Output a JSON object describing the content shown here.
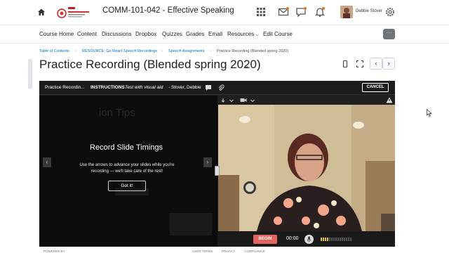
{
  "header": {
    "course_title": "COMM-101-042 - Effective Speaking",
    "user_name": "Debbie Stover",
    "icons": [
      "home-icon",
      "grid-icon",
      "mail-icon",
      "chat-icon",
      "bell-icon",
      "gear-icon"
    ]
  },
  "nav": {
    "items": [
      "Course Home",
      "Content",
      "Discussions",
      "Dropbox",
      "Quizzes",
      "Grades",
      "Email",
      "Resources",
      "Edit Course"
    ],
    "more_label": "···"
  },
  "breadcrumb": {
    "items": [
      "Table of Contents",
      "RESOURCE: Go React Speech Recordings",
      "Speech Assignments"
    ],
    "current": "Practice Recording (Blended spring 2020)",
    "separator": "›"
  },
  "page": {
    "title": "Practice Recording (Blended spring 2020)",
    "title_chevron": "⌄",
    "prev": "‹",
    "next": "›"
  },
  "recorder": {
    "activity": "Practice Recordin...",
    "instructions_label": "INSTRUCTIONS",
    "instructions_text": "Test with visual aid",
    "presenter": "- Stover, Debbie",
    "cancel_label": "CANCEL",
    "dialog_title": "Record Slide Timings",
    "dialog_body": "Use the arrows to advance your slides while you're recording — we'll take care of the rest!",
    "gotit_label": "Got it!",
    "slide_ghost_1": "ion Tips",
    "slide_prev": "‹",
    "slide_next": "›",
    "begin_label": "BEGIN",
    "timer": "00:00"
  },
  "footer": {
    "powered_by": "POWERED BY",
    "user_terms": "USER TERMS",
    "privacy": "PRIVACY",
    "compliance": "COMPLIANCE"
  },
  "colors": {
    "link": "#006fbf",
    "begin": "#e4645f",
    "recorder_bg": "#1f1f1f"
  }
}
